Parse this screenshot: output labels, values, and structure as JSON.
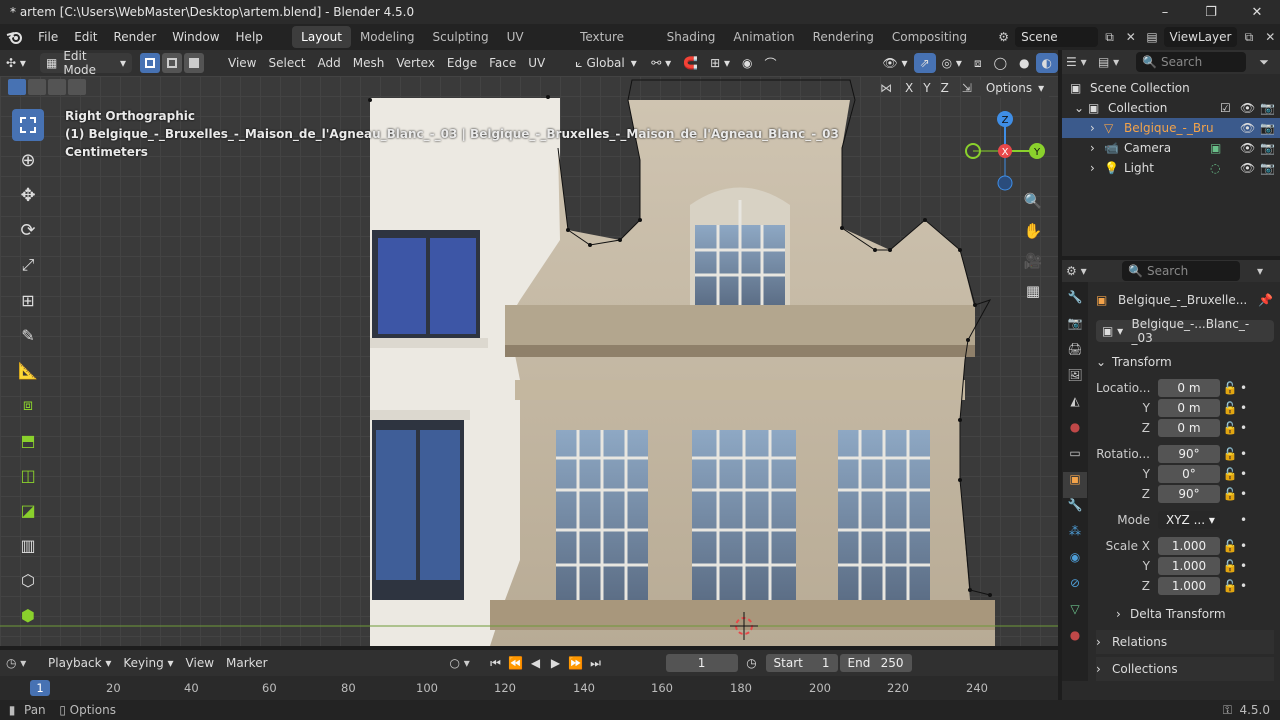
{
  "window": {
    "title": "* artem [C:\\Users\\WebMaster\\Desktop\\artem.blend] - Blender 4.5.0",
    "minimize": "–",
    "maximize": "❐",
    "close": "✕"
  },
  "menu": [
    "File",
    "Edit",
    "Render",
    "Window",
    "Help"
  ],
  "workspaces": [
    "Layout",
    "Modeling",
    "Sculpting",
    "UV Editing",
    "Texture Paint",
    "Shading",
    "Animation",
    "Rendering",
    "Compositing"
  ],
  "active_workspace": "Layout",
  "scene": "Scene",
  "view_layer": "ViewLayer",
  "viewport_header": {
    "mode": "Edit Mode",
    "menus": [
      "View",
      "Select",
      "Add",
      "Mesh",
      "Vertex",
      "Edge",
      "Face",
      "UV"
    ],
    "orientation": "Global",
    "options": "Options",
    "axes": [
      "X",
      "Y",
      "Z"
    ]
  },
  "viewport": {
    "view_name": "Right Orthographic",
    "object_info": "(1) Belgique_-_Bruxelles_-_Maison_de_l'Agneau_Blanc_-_03 | Belgique_-_Bruxelles_-_Maison_de_l'Agneau_Blanc_-_03",
    "units": "Centimeters",
    "gizmo": {
      "x": "X",
      "y": "Y",
      "z": "Z"
    }
  },
  "outliner": {
    "search_placeholder": "Search",
    "root": "Scene Collection",
    "collection": "Collection",
    "items": [
      "Belgique_-_Bru",
      "Camera",
      "Light"
    ]
  },
  "properties": {
    "search_placeholder": "Search",
    "object_name": "Belgique_-_Bruxelle...",
    "data_name": "Belgique_-...Blanc_-_03",
    "transform_label": "Transform",
    "location_label": "Locatio...",
    "location": [
      "0 m",
      "0 m",
      "0 m"
    ],
    "rotation_label": "Rotatio...",
    "rotation": [
      "90°",
      "0°",
      "90°"
    ],
    "mode_label": "Mode",
    "mode_value": "XYZ ...",
    "scale_label": "Scale X",
    "scale": [
      "1.000",
      "1.000",
      "1.000"
    ],
    "axis_y": "Y",
    "axis_z": "Z",
    "delta_transform": "Delta Transform",
    "relations": "Relations",
    "collections": "Collections"
  },
  "timeline": {
    "menus": [
      "Playback",
      "Keying",
      "View",
      "Marker"
    ],
    "current_frame": "1",
    "start_label": "Start",
    "start": "1",
    "end_label": "End",
    "end": "250",
    "ruler": [
      "1",
      "20",
      "40",
      "60",
      "80",
      "100",
      "120",
      "140",
      "160",
      "180",
      "200",
      "220",
      "240"
    ]
  },
  "status": {
    "pan": "Pan",
    "options": "Options",
    "version": "4.5.0"
  },
  "colors": {
    "accent": "#4772b3",
    "x_axis": "#e8484a",
    "y_axis": "#8ad12c",
    "z_axis": "#3f8ee6"
  }
}
